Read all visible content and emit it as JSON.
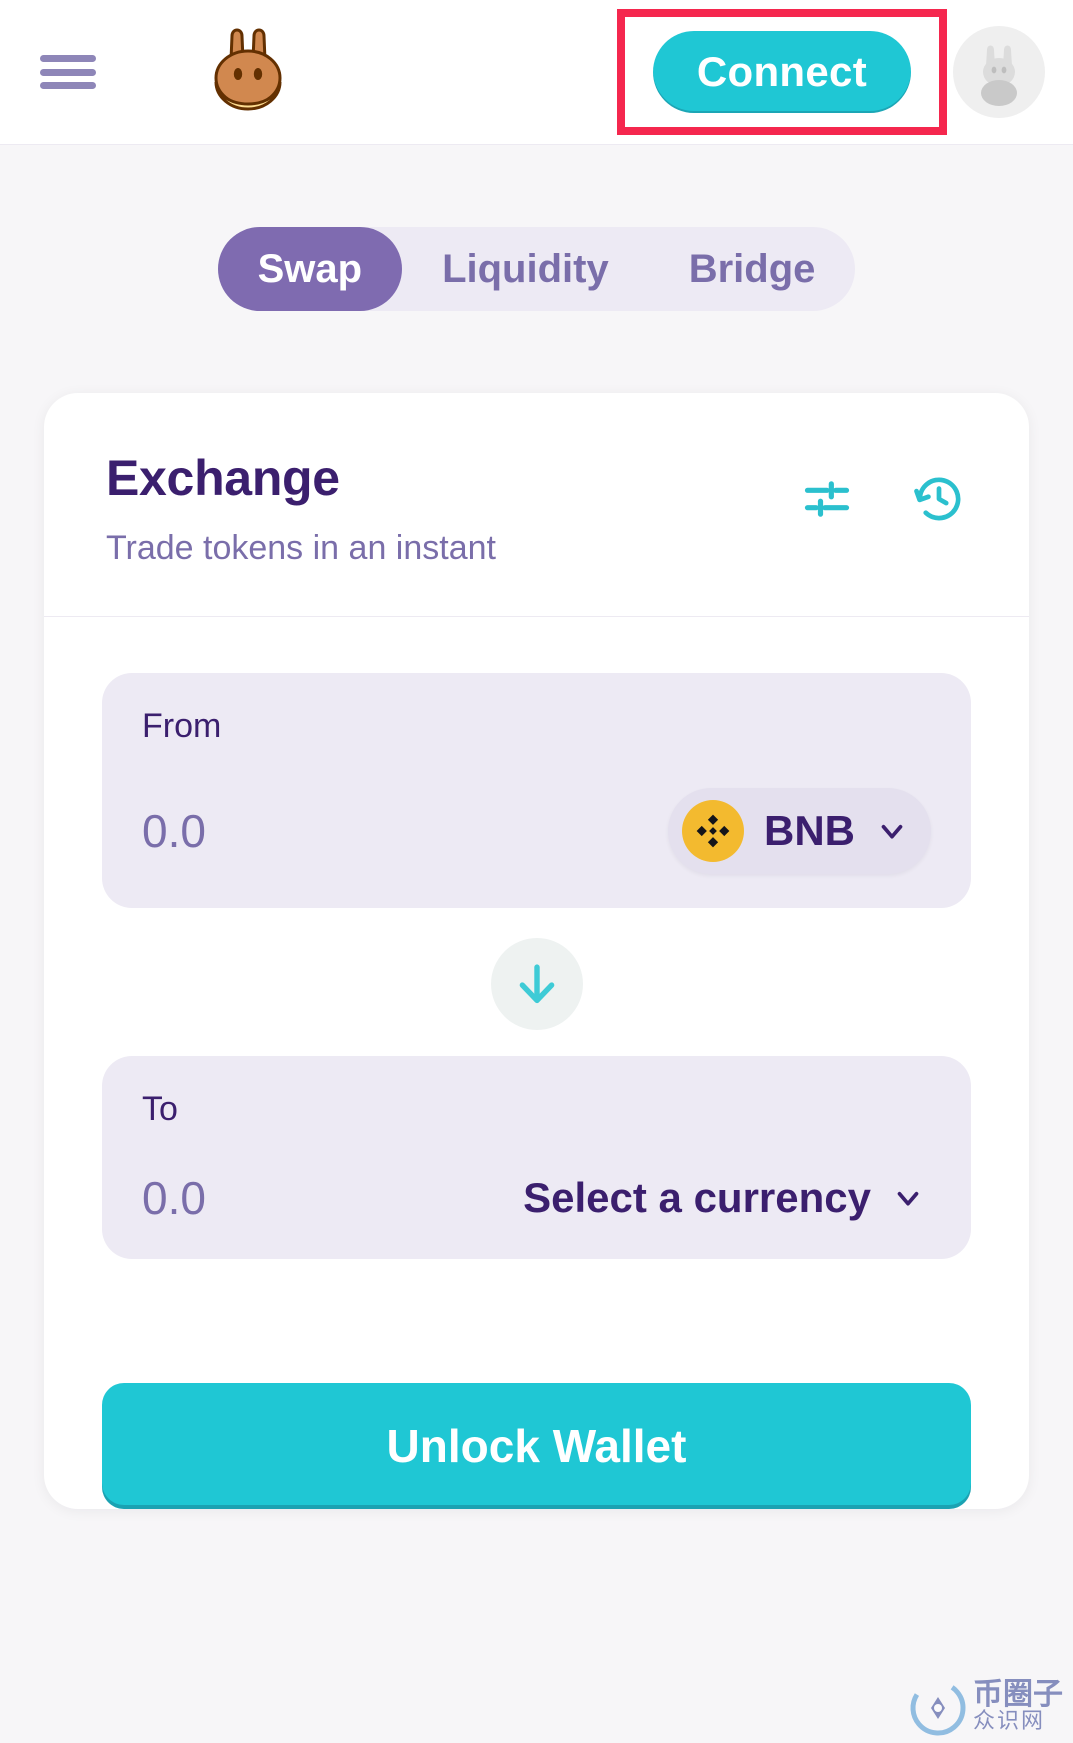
{
  "header": {
    "menu_icon": "hamburger-menu-icon",
    "logo_icon": "pancakeswap-bunny-logo",
    "connect_label": "Connect",
    "avatar_icon": "bunny-avatar-icon",
    "highlight_color": "#F5274E"
  },
  "tabs": [
    {
      "label": "Swap",
      "active": true
    },
    {
      "label": "Liquidity",
      "active": false
    },
    {
      "label": "Bridge",
      "active": false
    }
  ],
  "card": {
    "title": "Exchange",
    "subtitle": "Trade tokens in an instant",
    "settings_icon": "sliders-settings-icon",
    "history_icon": "history-clock-icon"
  },
  "swap": {
    "from": {
      "label": "From",
      "amount": "0.0",
      "amount_placeholder": "0.0",
      "token": "BNB",
      "token_logo_icon": "binance-bnb-icon",
      "chevron_icon": "chevron-down-icon"
    },
    "switch_icon": "arrow-down-icon",
    "to": {
      "label": "To",
      "amount": "0.0",
      "amount_placeholder": "0.0",
      "token": "Select a currency",
      "chevron_icon": "chevron-down-icon"
    },
    "cta_label": "Unlock Wallet"
  },
  "watermark": {
    "top": "币圈子",
    "bottom": "众识网"
  },
  "colors": {
    "primary": "#1FC7D4",
    "purple": "#7F6BB0",
    "dark_purple": "#3B1F6E",
    "muted_purple": "#7A6EAA",
    "panel": "#EDEAF4",
    "bnb_yellow": "#F3BA2F",
    "highlight_red": "#F5274E"
  }
}
